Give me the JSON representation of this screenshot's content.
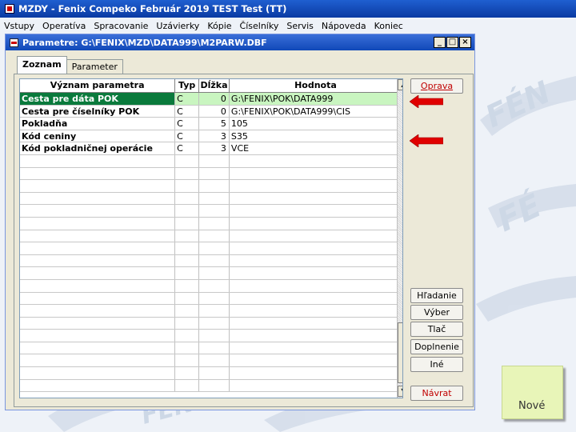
{
  "app": {
    "title": "MZDY - Fenix Compeko Február 2019   TEST Test (TT)"
  },
  "menu": [
    "Vstupy",
    "Operatíva",
    "Spracovanie",
    "Uzávierky",
    "Kópie",
    "Číselníky",
    "Servis",
    "Nápoveda",
    "Koniec"
  ],
  "window": {
    "title": "Parametre: G:\\FENIX\\MZD\\DATA999\\M2PARW.DBF",
    "btn_min": "_",
    "btn_max": "□",
    "btn_close": "×"
  },
  "tabs": [
    {
      "label": "Zoznam",
      "active": true
    },
    {
      "label": "Parameter",
      "active": false
    }
  ],
  "grid": {
    "headers": [
      "Význam parametra",
      "Typ",
      "Dĺžka",
      "Hodnota"
    ],
    "rows": [
      {
        "name": "Cesta pre dáta POK",
        "type": "C",
        "length": "0",
        "value": "G:\\FENIX\\POK\\DATA999"
      },
      {
        "name": "Cesta pre  číselníky POK",
        "type": "C",
        "length": "0",
        "value": "G:\\FENIX\\POK\\DATA999\\CIS"
      },
      {
        "name": "Pokladňa",
        "type": "C",
        "length": "5",
        "value": "105"
      },
      {
        "name": "Kód ceniny",
        "type": "C",
        "length": "3",
        "value": "S35"
      },
      {
        "name": "Kód pokladničnej operácie",
        "type": "C",
        "length": "3",
        "value": "VCE"
      }
    ],
    "selected_row": 0,
    "scroll_up": "▲",
    "scroll_down": "▼"
  },
  "buttons": {
    "oprava": "Oprava",
    "hladanie": "Hľadanie",
    "vyber": "Výber",
    "tlac": "Tlač",
    "doplnenie": "Doplnenie",
    "ine": "Iné",
    "navrat": "Návrat"
  },
  "note": {
    "text": "Nové"
  },
  "colors": {
    "selected_cell": "#0a7a3c",
    "selected_row_bg": "#c9f5c0",
    "arrow": "#e00000",
    "note_bg": "#e8f5b8"
  }
}
